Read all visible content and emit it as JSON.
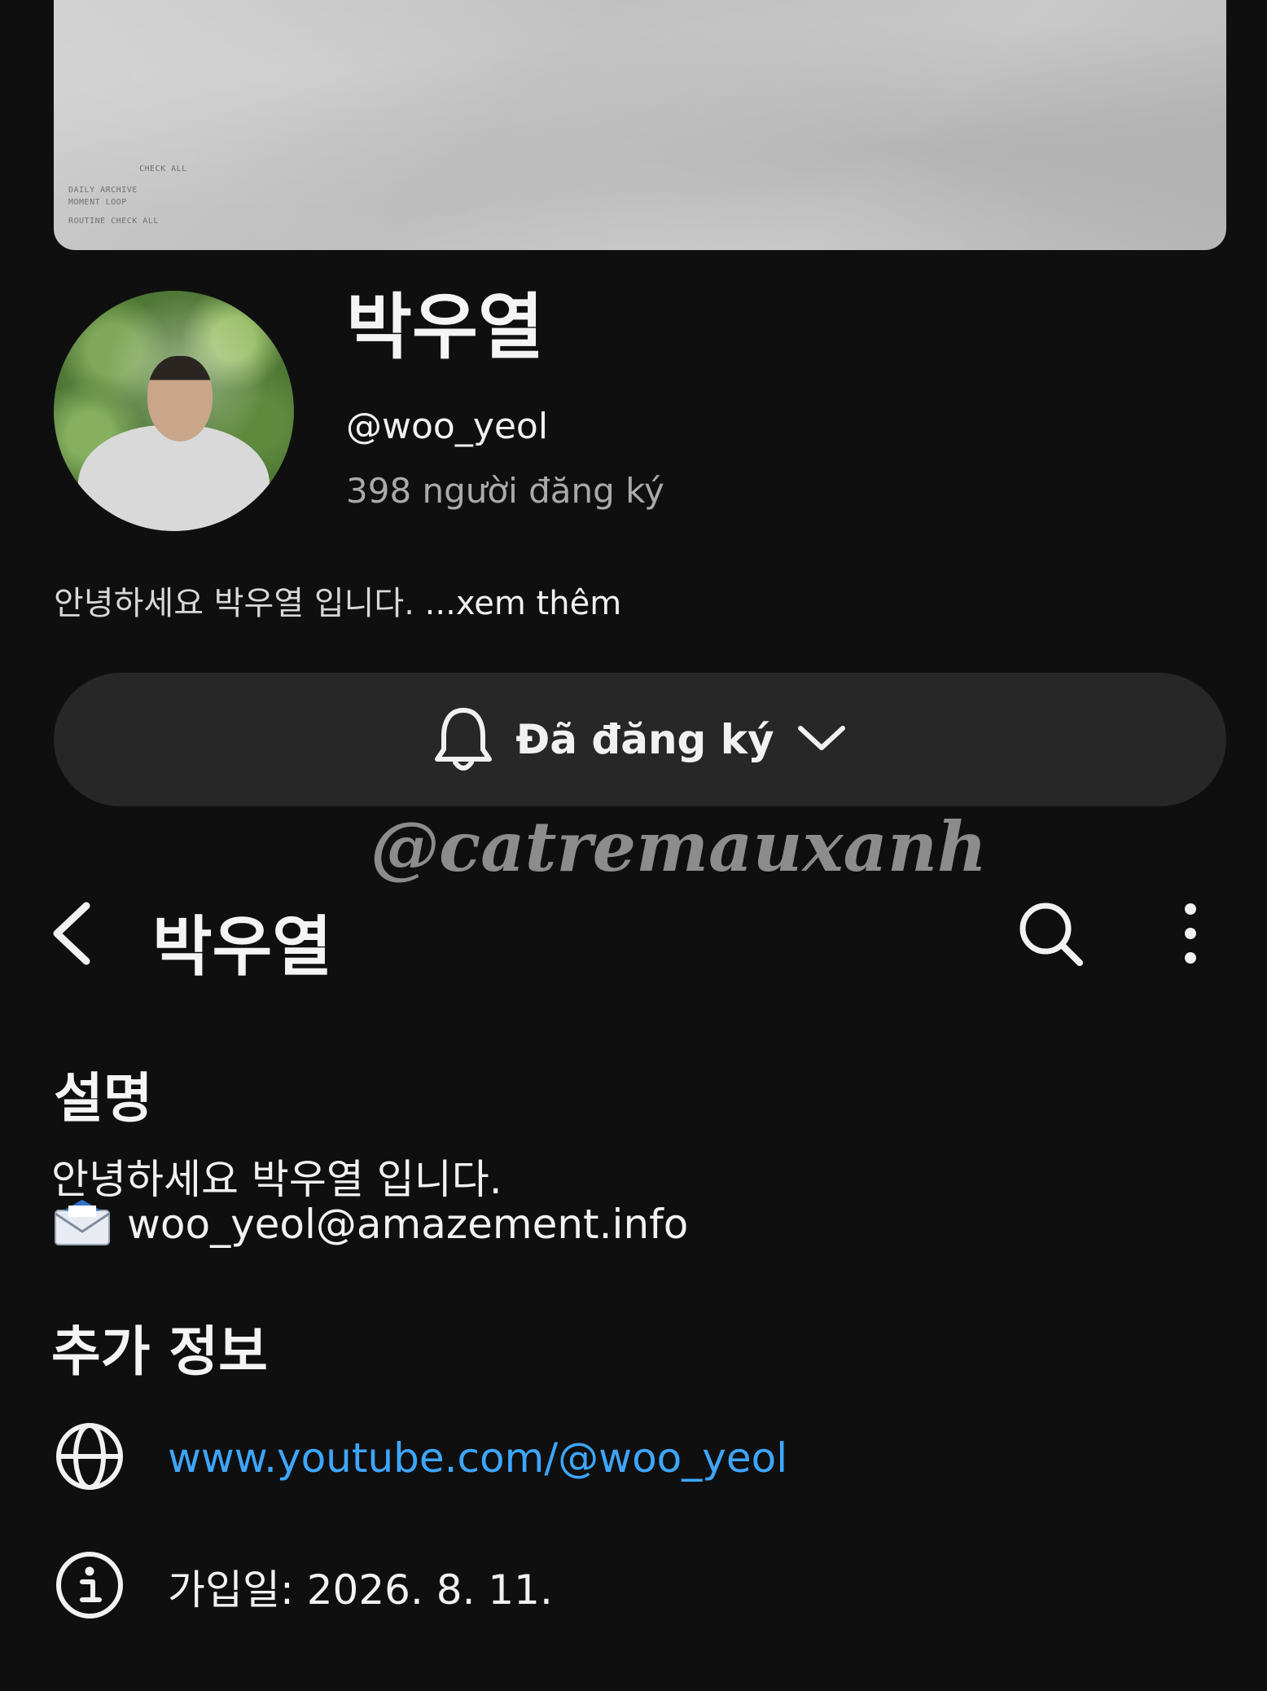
{
  "banner": {
    "line1": "CHECK ALL",
    "line2": "DAILY ARCHIVE",
    "line3": "MOMENT LOOP",
    "line4": "ROUTINE CHECK ALL"
  },
  "channel": {
    "name": "박우열",
    "handle": "@woo_yeol",
    "subscribers": "398 người đăng ký",
    "bio_short": "안녕하세요 박우열 입니다.",
    "bio_more": "...xem thêm"
  },
  "subscribe": {
    "label": "Đã đăng ký",
    "icons": [
      "bell-icon",
      "chevron-down-icon"
    ]
  },
  "watermark": "@catremauxanh",
  "topbar": {
    "title": "박우열",
    "icons": [
      "back-arrow-icon",
      "search-icon",
      "more-vert-icon"
    ]
  },
  "about": {
    "description_heading": "설명",
    "description_text": "안녕하세요 박우열 입니다.",
    "email": "woo_yeol@amazement.info",
    "more_info_heading": "추가 정보",
    "link": "www.youtube.com/@woo_yeol",
    "joined": "가입일: 2026. 8. 11.",
    "icons": [
      "envelope-icon",
      "globe-icon",
      "info-icon"
    ]
  },
  "colors": {
    "background": "#0f0f0f",
    "button": "#272727",
    "link": "#3ea6ff"
  }
}
